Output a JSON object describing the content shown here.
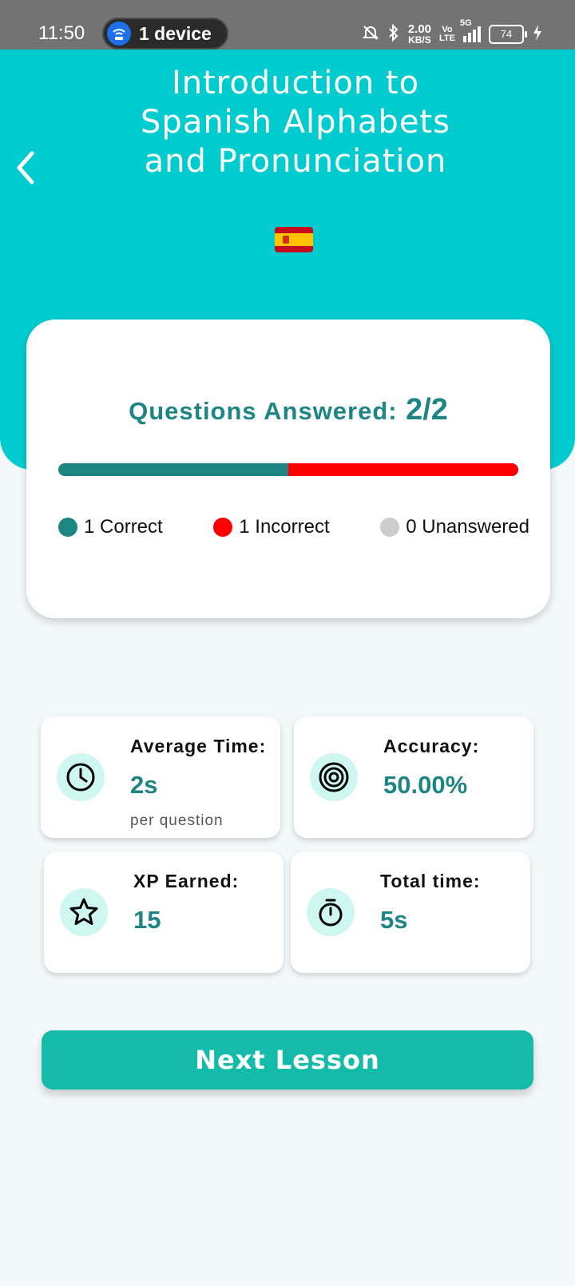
{
  "status_bar": {
    "time": "11:50",
    "hotspot_label": "1 device",
    "net_speed_value": "2.00",
    "net_speed_unit": "KB/S",
    "volte_top": "Vo",
    "volte_bottom": "LTE",
    "network": "5G",
    "battery": "74"
  },
  "header": {
    "title": "Introduction to Spanish Alphabets and Pronunciation",
    "flag_icon": "spain-flag-icon",
    "color": "#00CCD0"
  },
  "progress": {
    "label": "Questions Answered:",
    "value": "2/2",
    "correct_fraction": 0.5,
    "incorrect_fraction": 0.5,
    "unanswered_fraction": 0.0,
    "legend": {
      "correct": "1 Correct",
      "incorrect": "1 Incorrect",
      "unanswered": "0 Unanswered"
    },
    "colors": {
      "correct": "#1E8585",
      "incorrect": "#FF0000",
      "unanswered": "#CCCCCC"
    }
  },
  "stats": {
    "average_time": {
      "label": "Average Time:",
      "value": "2s",
      "sub": "per question",
      "icon": "clock-icon"
    },
    "accuracy": {
      "label": "Accuracy:",
      "value": "50.00%",
      "icon": "target-icon"
    },
    "xp": {
      "label": "XP Earned:",
      "value": "15",
      "icon": "star-icon"
    },
    "total_time": {
      "label": "Total time:",
      "value": "5s",
      "icon": "stopwatch-icon"
    }
  },
  "actions": {
    "next_label": "Next Lesson",
    "button_color": "#13BBA8"
  }
}
